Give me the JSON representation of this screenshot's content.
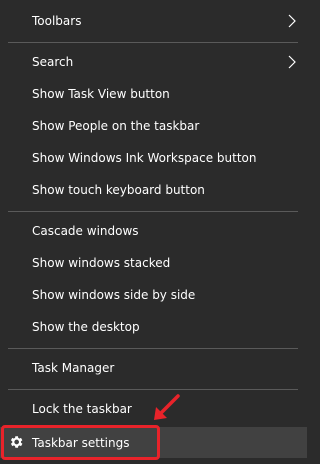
{
  "menu": {
    "toolbars": "Toolbars",
    "search": "Search",
    "show_task_view": "Show Task View button",
    "show_people": "Show People on the taskbar",
    "show_ink": "Show Windows Ink Workspace button",
    "show_touch_keyboard": "Show touch keyboard button",
    "cascade": "Cascade windows",
    "stacked": "Show windows stacked",
    "side_by_side": "Show windows side by side",
    "show_desktop": "Show the desktop",
    "task_manager": "Task Manager",
    "lock_taskbar": "Lock the taskbar",
    "taskbar_settings": "Taskbar settings"
  },
  "icons": {
    "submenu": "chevron-right-icon",
    "settings": "gear-icon",
    "annotation": "red-arrow-icon"
  },
  "colors": {
    "background": "#2b2b2b",
    "hover": "#414141",
    "divider": "#5a5a5a",
    "text": "#ffffff",
    "annotation": "#e8232a"
  }
}
